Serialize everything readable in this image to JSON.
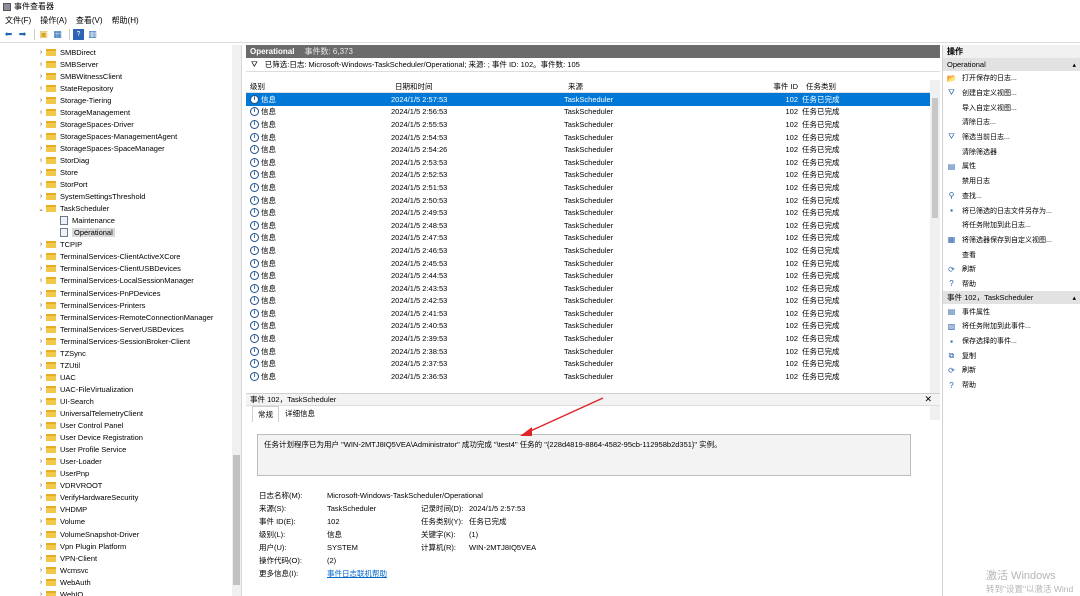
{
  "window": {
    "title": "事件查看器"
  },
  "menu": [
    "文件(F)",
    "操作(A)",
    "查看(V)",
    "帮助(H)"
  ],
  "toolbar_icons": [
    "back-icon",
    "forward-icon",
    "folder-up-icon",
    "console-tree-icon",
    "help-icon",
    "panel-icon"
  ],
  "tree": {
    "items": [
      {
        "label": "SMBDirect",
        "expanded": false
      },
      {
        "label": "SMBServer",
        "expanded": false
      },
      {
        "label": "SMBWitnessClient",
        "expanded": false
      },
      {
        "label": "StateRepository",
        "expanded": false
      },
      {
        "label": "Storage-Tiering",
        "expanded": false
      },
      {
        "label": "StorageManagement",
        "expanded": false
      },
      {
        "label": "StorageSpaces-Driver",
        "expanded": false
      },
      {
        "label": "StorageSpaces-ManagementAgent",
        "expanded": false
      },
      {
        "label": "StorageSpaces-SpaceManager",
        "expanded": false
      },
      {
        "label": "StorDiag",
        "expanded": false
      },
      {
        "label": "Store",
        "expanded": false
      },
      {
        "label": "StorPort",
        "expanded": false
      },
      {
        "label": "SystemSettingsThreshold",
        "expanded": false
      },
      {
        "label": "TaskScheduler",
        "expanded": true
      },
      {
        "label": "Maintenance",
        "child": true
      },
      {
        "label": "Operational",
        "child": true,
        "selected": true
      },
      {
        "label": "TCPIP",
        "expanded": false
      },
      {
        "label": "TerminalServices-ClientActiveXCore",
        "expanded": false
      },
      {
        "label": "TerminalServices-ClientUSBDevices",
        "expanded": false
      },
      {
        "label": "TerminalServices-LocalSessionManager",
        "expanded": false
      },
      {
        "label": "TerminalServices-PnPDevices",
        "expanded": false
      },
      {
        "label": "TerminalServices-Printers",
        "expanded": false
      },
      {
        "label": "TerminalServices-RemoteConnectionManager",
        "expanded": false
      },
      {
        "label": "TerminalServices-ServerUSBDevices",
        "expanded": false
      },
      {
        "label": "TerminalServices-SessionBroker-Client",
        "expanded": false
      },
      {
        "label": "TZSync",
        "expanded": false
      },
      {
        "label": "TZUtil",
        "expanded": false
      },
      {
        "label": "UAC",
        "expanded": false
      },
      {
        "label": "UAC-FileVirtualization",
        "expanded": false
      },
      {
        "label": "UI-Search",
        "expanded": false
      },
      {
        "label": "UniversalTelemetryClient",
        "expanded": false
      },
      {
        "label": "User Control Panel",
        "expanded": false
      },
      {
        "label": "User Device Registration",
        "expanded": false
      },
      {
        "label": "User Profile Service",
        "expanded": false
      },
      {
        "label": "User-Loader",
        "expanded": false
      },
      {
        "label": "UserPnp",
        "expanded": false
      },
      {
        "label": "VDRVROOT",
        "expanded": false
      },
      {
        "label": "VerifyHardwareSecurity",
        "expanded": false
      },
      {
        "label": "VHDMP",
        "expanded": false
      },
      {
        "label": "Volume",
        "expanded": false
      },
      {
        "label": "VolumeSnapshot-Driver",
        "expanded": false
      },
      {
        "label": "Vpn Plugin Platform",
        "expanded": false
      },
      {
        "label": "VPN-Client",
        "expanded": false
      },
      {
        "label": "Wcmsvc",
        "expanded": false
      },
      {
        "label": "WebAuth",
        "expanded": false
      },
      {
        "label": "WebIO",
        "expanded": false
      }
    ]
  },
  "center": {
    "header_title": "Operational",
    "header_count": "事件数: 6,373",
    "filter_text": "已筛选:日志: Microsoft-Windows-TaskScheduler/Operational; 来源: ; 事件 ID: 102。事件数: 105",
    "columns": [
      "级别",
      "日期和时间",
      "来源",
      "事件 ID",
      "任务类别"
    ],
    "rows": [
      [
        "信息",
        "2024/1/5 2:57:53",
        "TaskScheduler",
        "102",
        "任务已完成"
      ],
      [
        "信息",
        "2024/1/5 2:56:53",
        "TaskScheduler",
        "102",
        "任务已完成"
      ],
      [
        "信息",
        "2024/1/5 2:55:53",
        "TaskScheduler",
        "102",
        "任务已完成"
      ],
      [
        "信息",
        "2024/1/5 2:54:53",
        "TaskScheduler",
        "102",
        "任务已完成"
      ],
      [
        "信息",
        "2024/1/5 2:54:26",
        "TaskScheduler",
        "102",
        "任务已完成"
      ],
      [
        "信息",
        "2024/1/5 2:53:53",
        "TaskScheduler",
        "102",
        "任务已完成"
      ],
      [
        "信息",
        "2024/1/5 2:52:53",
        "TaskScheduler",
        "102",
        "任务已完成"
      ],
      [
        "信息",
        "2024/1/5 2:51:53",
        "TaskScheduler",
        "102",
        "任务已完成"
      ],
      [
        "信息",
        "2024/1/5 2:50:53",
        "TaskScheduler",
        "102",
        "任务已完成"
      ],
      [
        "信息",
        "2024/1/5 2:49:53",
        "TaskScheduler",
        "102",
        "任务已完成"
      ],
      [
        "信息",
        "2024/1/5 2:48:53",
        "TaskScheduler",
        "102",
        "任务已完成"
      ],
      [
        "信息",
        "2024/1/5 2:47:53",
        "TaskScheduler",
        "102",
        "任务已完成"
      ],
      [
        "信息",
        "2024/1/5 2:46:53",
        "TaskScheduler",
        "102",
        "任务已完成"
      ],
      [
        "信息",
        "2024/1/5 2:45:53",
        "TaskScheduler",
        "102",
        "任务已完成"
      ],
      [
        "信息",
        "2024/1/5 2:44:53",
        "TaskScheduler",
        "102",
        "任务已完成"
      ],
      [
        "信息",
        "2024/1/5 2:43:53",
        "TaskScheduler",
        "102",
        "任务已完成"
      ],
      [
        "信息",
        "2024/1/5 2:42:53",
        "TaskScheduler",
        "102",
        "任务已完成"
      ],
      [
        "信息",
        "2024/1/5 2:41:53",
        "TaskScheduler",
        "102",
        "任务已完成"
      ],
      [
        "信息",
        "2024/1/5 2:40:53",
        "TaskScheduler",
        "102",
        "任务已完成"
      ],
      [
        "信息",
        "2024/1/5 2:39:53",
        "TaskScheduler",
        "102",
        "任务已完成"
      ],
      [
        "信息",
        "2024/1/5 2:38:53",
        "TaskScheduler",
        "102",
        "任务已完成"
      ],
      [
        "信息",
        "2024/1/5 2:37:53",
        "TaskScheduler",
        "102",
        "任务已完成"
      ],
      [
        "信息",
        "2024/1/5 2:36:53",
        "TaskScheduler",
        "102",
        "任务已完成"
      ]
    ],
    "selected_row": 0
  },
  "detail": {
    "title": "事件 102，TaskScheduler",
    "tabs": [
      "常规",
      "详细信息"
    ],
    "active_tab": 0,
    "message": "任务计划程序已为用户 \"WIN-2MTJ8IQ5VEA\\Administrator\" 成功完成 \"\\test4\" 任务的 \"{228d4819-8864-4582-95cb-112958b2d351}\" 实例。",
    "props": {
      "log_name_label": "日志名称(M):",
      "log_name": "Microsoft-Windows-TaskScheduler/Operational",
      "source_label": "来源(S):",
      "source": "TaskScheduler",
      "logged_label": "记录时间(D):",
      "logged": "2024/1/5 2:57:53",
      "event_id_label": "事件 ID(E):",
      "event_id": "102",
      "task_cat_label": "任务类别(Y):",
      "task_cat": "任务已完成",
      "level_label": "级别(L):",
      "level": "信息",
      "keywords_label": "关键字(K):",
      "keywords": "(1)",
      "user_label": "用户(U):",
      "user": "SYSTEM",
      "computer_label": "计算机(R):",
      "computer": "WIN-2MTJ8IQ5VEA",
      "opcode_label": "操作代码(O):",
      "opcode": "(2)",
      "more_info_label": "更多信息(I):",
      "more_info": "事件日志联机帮助"
    }
  },
  "actions": {
    "title": "操作",
    "section1": "Operational",
    "items1": [
      {
        "icon": "open-log-icon",
        "label": "打开保存的日志..."
      },
      {
        "icon": "filter-create-icon",
        "label": "创建自定义视图..."
      },
      {
        "icon": "",
        "label": "导入自定义视图..."
      },
      {
        "icon": "",
        "label": "清除日志..."
      },
      {
        "icon": "filter-icon",
        "label": "筛选当前日志..."
      },
      {
        "icon": "",
        "label": "清除筛选器"
      },
      {
        "icon": "properties-icon",
        "label": "属性"
      },
      {
        "icon": "",
        "label": "禁用日志"
      },
      {
        "icon": "find-icon",
        "label": "查找..."
      },
      {
        "icon": "save-icon",
        "label": "将已筛选的日志文件另存为..."
      },
      {
        "icon": "",
        "label": "将任务附加到此日志..."
      },
      {
        "icon": "save-filter-icon",
        "label": "将筛选器保存到自定义视图..."
      },
      {
        "icon": "",
        "label": "查看"
      },
      {
        "icon": "refresh-icon",
        "label": "刷新"
      },
      {
        "icon": "help-icon",
        "label": "帮助"
      }
    ],
    "section2": "事件 102，TaskScheduler",
    "items2": [
      {
        "icon": "event-properties-icon",
        "label": "事件属性"
      },
      {
        "icon": "attach-task-icon",
        "label": "将任务附加到此事件..."
      },
      {
        "icon": "save-icon",
        "label": "保存选择的事件..."
      },
      {
        "icon": "copy-icon",
        "label": "复制"
      },
      {
        "icon": "refresh-icon",
        "label": "刷新"
      },
      {
        "icon": "help-icon",
        "label": "帮助"
      }
    ]
  },
  "watermark": {
    "line1": "激活 Windows",
    "line2": "转到\"设置\"以激活 Wind"
  },
  "colors": {
    "selection": "#0078d7",
    "header": "#6b6b6b",
    "annotation_arrow": "#e0242b"
  }
}
